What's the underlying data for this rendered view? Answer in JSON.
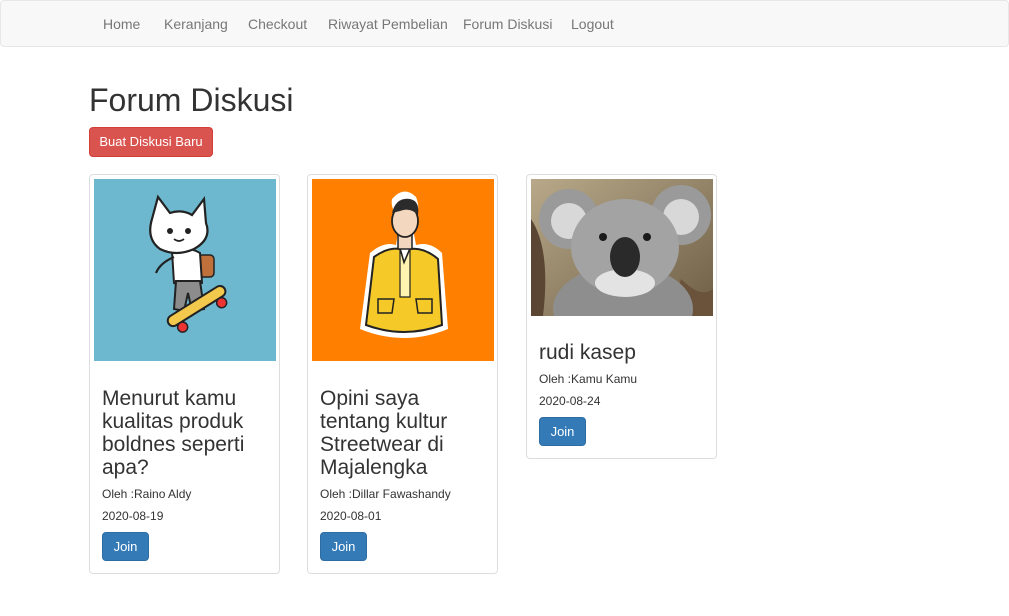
{
  "nav": {
    "items": [
      "Home",
      "Keranjang",
      "Checkout",
      "Riwayat Pembelian",
      "Forum Diskusi",
      "Logout"
    ]
  },
  "page": {
    "title": "Forum Diskusi",
    "new_button": "Buat Diskusi Baru"
  },
  "cards": [
    {
      "title": "Menurut kamu kualitas produk boldnes seperti apa?",
      "author": "Oleh :Raino Aldy",
      "date": "2020-08-19",
      "join": "Join",
      "image": "cat-skateboard-illustration",
      "image_bg": "#6db8cf"
    },
    {
      "title": "Opini saya tentang kultur Streetwear di Majalengka",
      "author": "Oleh :Dillar Fawashandy",
      "date": "2020-08-01",
      "join": "Join",
      "image": "man-yellow-jacket-illustration",
      "image_bg": "#ff7f00"
    },
    {
      "title": "rudi kasep",
      "author": "Oleh :Kamu Kamu",
      "date": "2020-08-24",
      "join": "Join",
      "image": "koala-photo",
      "image_bg": "#9a8a72"
    }
  ],
  "colors": {
    "danger": "#d9534f",
    "primary": "#337ab7",
    "nav_bg": "#f8f8f8"
  }
}
